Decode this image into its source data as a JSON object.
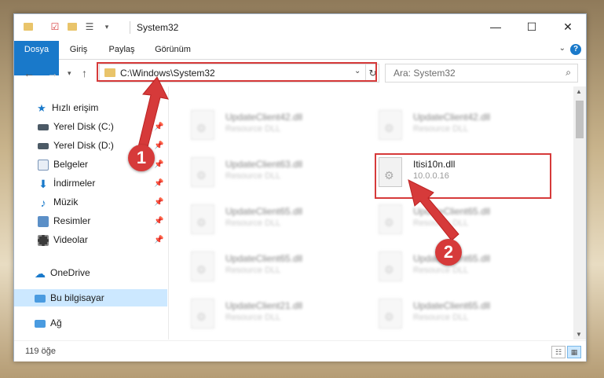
{
  "window": {
    "title": "System32",
    "controls": {
      "minimize": "—",
      "maximize": "☐",
      "close": "✕"
    }
  },
  "ribbon": {
    "tabs": [
      "Dosya",
      "Giriş",
      "Paylaş",
      "Görünüm"
    ],
    "help": "?"
  },
  "address": {
    "path": "C:\\Windows\\System32",
    "search_placeholder": "Ara: System32"
  },
  "sidebar": {
    "items": [
      {
        "label": "Hızlı erişim",
        "icon": "star-icon",
        "pinned": false
      },
      {
        "label": "Yerel Disk (C:)",
        "icon": "drive-icon",
        "pinned": true
      },
      {
        "label": "Yerel Disk (D:)",
        "icon": "drive-icon",
        "pinned": true
      },
      {
        "label": "Belgeler",
        "icon": "documents-icon",
        "pinned": true
      },
      {
        "label": "İndirmeler",
        "icon": "download-icon",
        "pinned": true
      },
      {
        "label": "Müzik",
        "icon": "music-icon",
        "pinned": true
      },
      {
        "label": "Resimler",
        "icon": "pictures-icon",
        "pinned": true
      },
      {
        "label": "Videolar",
        "icon": "videos-icon",
        "pinned": true
      },
      {
        "label": "OneDrive",
        "icon": "cloud-icon",
        "pinned": false
      },
      {
        "label": "Bu bilgisayar",
        "icon": "computer-icon",
        "pinned": false,
        "selected": true
      },
      {
        "label": "Ağ",
        "icon": "network-icon",
        "pinned": false
      }
    ]
  },
  "files": {
    "left_column": [
      {
        "name": "UpdateClient42.dll",
        "type": "Resource DLL"
      },
      {
        "name": "UpdateClient63.dll",
        "type": "Resource DLL"
      },
      {
        "name": "UpdateClient65.dll",
        "type": "Resource DLL"
      },
      {
        "name": "UpdateClient65.dll",
        "type": "Resource DLL"
      },
      {
        "name": "UpdateClient21.dll",
        "type": "Resource DLL"
      }
    ],
    "right_column": [
      {
        "name": "UpdateClient42.dll",
        "type": "Resource DLL"
      },
      {
        "name": "Itisi10n.dll",
        "type": "10.0.0.16",
        "highlighted": true
      },
      {
        "name": "UpdateClient65.dll",
        "type": "Resource DLL"
      },
      {
        "name": "UpdateClient65.dll",
        "type": "Resource DLL"
      },
      {
        "name": "UpdateClient65.dll",
        "type": "Resource DLL"
      }
    ]
  },
  "status": {
    "item_count": "119 öğe"
  },
  "annotations": {
    "badge_1": "1",
    "badge_2": "2",
    "color": "#d63a3a"
  }
}
